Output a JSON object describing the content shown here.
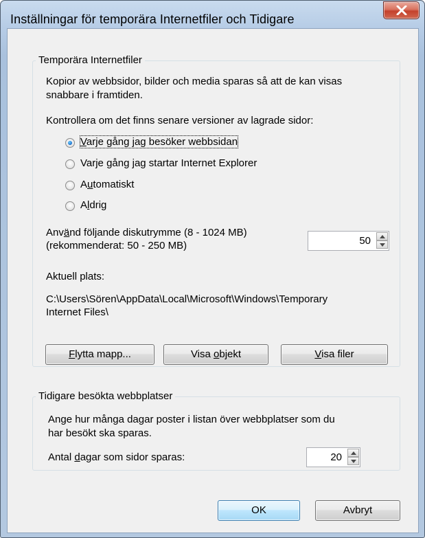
{
  "window": {
    "title": "Inställningar för temporära Internetfiler och Tidigare"
  },
  "temp_files": {
    "legend": "Temporära Internetfiler",
    "description_line1": "Kopior av webbsidor, bilder och media sparas så att de kan visas",
    "description_line2": "snabbare i framtiden.",
    "check_label": "Kontrollera om det finns senare versioner av lagrade sidor:",
    "radio_options": [
      {
        "label": "Varje gång jag besöker webbsidan",
        "checked": true
      },
      {
        "label": "Varje gång jag startar Internet Explorer",
        "checked": false
      },
      {
        "label": "Automatiskt",
        "checked": false
      },
      {
        "label": "Aldrig",
        "checked": false
      }
    ],
    "disk_label_line1": "Använd följande diskutrymme (8 - 1024 MB)",
    "disk_label_line2": "(rekommenderat: 50 - 250 MB)",
    "disk_value": "50",
    "location_label": "Aktuell plats:",
    "location_line1": "C:\\Users\\Sören\\AppData\\Local\\Microsoft\\Windows\\Temporary",
    "location_line2": "Internet Files\\",
    "buttons": {
      "move": "Flytta mapp...",
      "view_objects": "Visa objekt",
      "view_files": "Visa filer"
    }
  },
  "history": {
    "legend": "Tidigare besökta webbplatser",
    "description_line1": "Ange hur många dagar poster i listan över webbplatser som du",
    "description_line2": "har besökt ska sparas.",
    "days_label": "Antal dagar som sidor sparas:",
    "days_value": "20"
  },
  "footer": {
    "ok": "OK",
    "cancel": "Avbryt"
  },
  "colors": {
    "close": "#c4412c",
    "default_button": "#3c7fb1",
    "radio_checked": "#1b6ac9"
  }
}
